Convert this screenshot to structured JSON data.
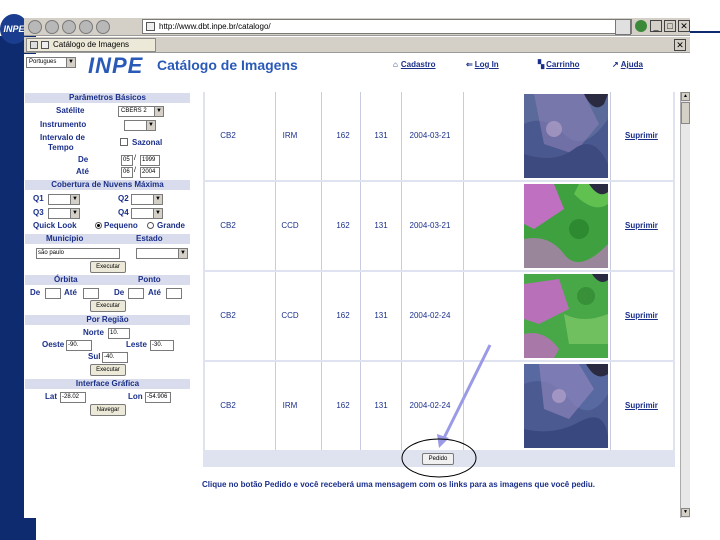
{
  "logo_text": "INPE",
  "browser": {
    "url": "http://www.dbt.inpe.br/catalogo/",
    "tab_label": "Catálogo de Imagens",
    "close_glyph": "✕"
  },
  "header": {
    "language": "Portugues",
    "brand": "INPE",
    "title": "Catálogo de Imagens",
    "nav": [
      "Cadastro",
      "Log In",
      "Carrinho",
      "Ajuda"
    ]
  },
  "panel": {
    "basic_section": "Parâmetros Básicos",
    "satellite_label": "Satélite",
    "satellite_value": "CBERS 2",
    "instrument_label": "Instrumento",
    "interval_label1": "Intervalo de",
    "interval_label2": "Tempo",
    "seasonal_label": "Sazonal",
    "from_label": "De",
    "from_month": "05",
    "from_year": "1999",
    "to_label": "Até",
    "to_month": "06",
    "to_year": "2004",
    "slash": "/",
    "cloud_section": "Cobertura de Nuvens Máxima",
    "q1": "Q1",
    "q2": "Q2",
    "q3": "Q3",
    "q4": "Q4",
    "quicklook_label": "Quick Look",
    "small_label": "Pequeno",
    "large_label": "Grande",
    "municipio_label": "Município",
    "estado_label": "Estado",
    "municipio_value": "são paulo",
    "execute_label": "Executar",
    "orbita_label": "Órbita",
    "ponto_label": "Ponto",
    "de_label": "De",
    "ate_label": "Até",
    "region_section": "Por Região",
    "norte_label": "Norte",
    "norte_value": "10.",
    "oeste_label": "Oeste",
    "oeste_value": "-90.",
    "leste_label": "Leste",
    "leste_value": "-30.",
    "sul_label": "Sul",
    "sul_value": "-40.",
    "graphic_section": "Interface Gráfica",
    "lat_label": "Lat",
    "lat_value": "-28.02",
    "lon_label": "Lon",
    "lon_value": "-54.906",
    "navigate_label": "Navegar"
  },
  "results": {
    "rows": [
      {
        "sat": "CB2",
        "inst": "IRM",
        "orbit": "162",
        "point": "131",
        "date": "2004-03-21",
        "action": "Suprimir"
      },
      {
        "sat": "CB2",
        "inst": "CCD",
        "orbit": "162",
        "point": "131",
        "date": "2004-03-21",
        "action": "Suprimir"
      },
      {
        "sat": "CB2",
        "inst": "CCD",
        "orbit": "162",
        "point": "131",
        "date": "2004-02-24",
        "action": "Suprimir"
      },
      {
        "sat": "CB2",
        "inst": "IRM",
        "orbit": "162",
        "point": "131",
        "date": "2004-02-24",
        "action": "Suprimir"
      }
    ],
    "order_button": "Pedido"
  },
  "footer_text": "Clique no botão Pedido e você receberá uma mensagem com os links para as imagens que você pediu.",
  "colors": {
    "slide_blue": "#0d2b6e",
    "text_blue": "#1a2f8a",
    "section_bg": "#d8dcec",
    "arrow": "#9a9ae6"
  }
}
